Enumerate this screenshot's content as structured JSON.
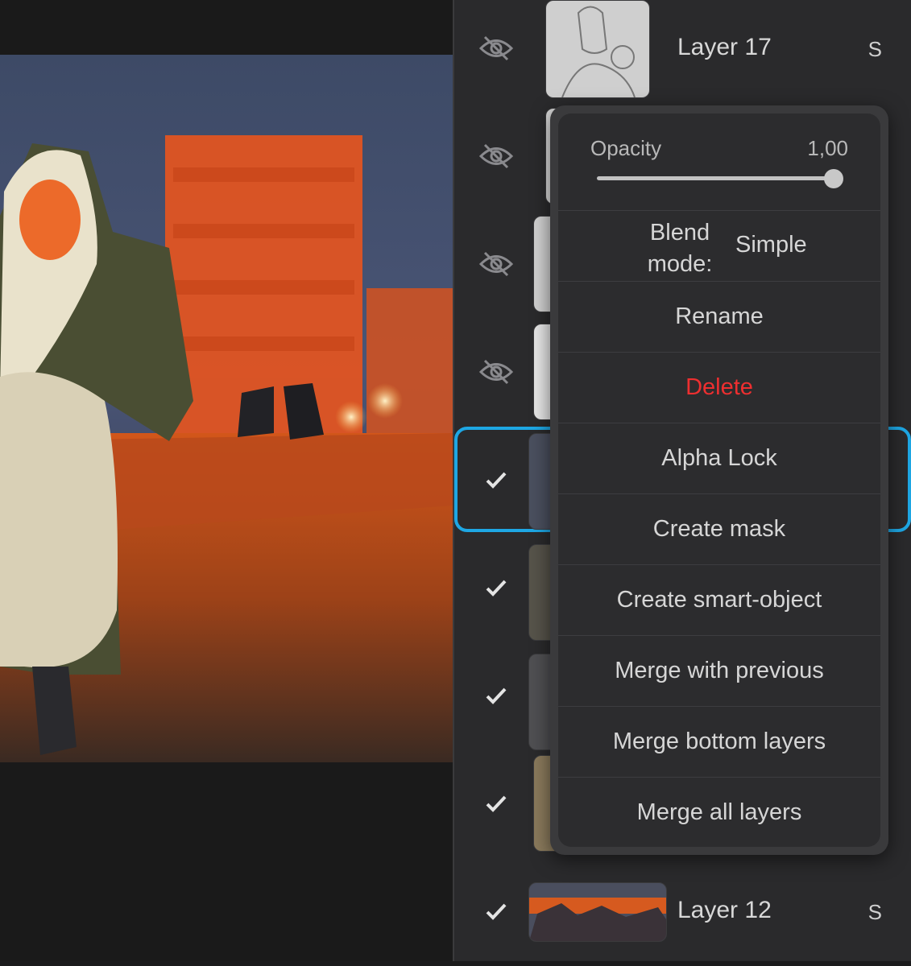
{
  "layers": [
    {
      "name": "Layer 17",
      "blend_badge": "S",
      "visible": false
    },
    {
      "name": "",
      "visible": false
    },
    {
      "name": "",
      "visible": false
    },
    {
      "name": "",
      "visible": false
    },
    {
      "name": "",
      "visible": true,
      "selected": true
    },
    {
      "name": "",
      "visible": true
    },
    {
      "name": "",
      "visible": true
    },
    {
      "name": "",
      "visible": true
    },
    {
      "name": "Layer 12",
      "blend_badge": "S",
      "visible": true
    }
  ],
  "menu": {
    "opacity_label": "Opacity",
    "opacity_value": "1,00",
    "opacity_level": 1.0,
    "blend_label": "Blend mode:",
    "blend_value": "Simple",
    "items": [
      {
        "label": "Rename"
      },
      {
        "label": "Delete",
        "danger": true
      },
      {
        "label": "Alpha Lock"
      },
      {
        "label": "Create mask"
      },
      {
        "label": "Create smart-object"
      },
      {
        "label": "Merge with previous"
      },
      {
        "label": "Merge bottom layers"
      },
      {
        "label": "Merge all layers"
      }
    ]
  },
  "colors": {
    "accent": "#1ea7e4",
    "danger": "#ee2f30",
    "panel": "#2a2a2c",
    "menu": "#2c2c2e"
  },
  "icons": {
    "hidden": "eye-slash-icon",
    "visible": "checkmark-icon"
  }
}
